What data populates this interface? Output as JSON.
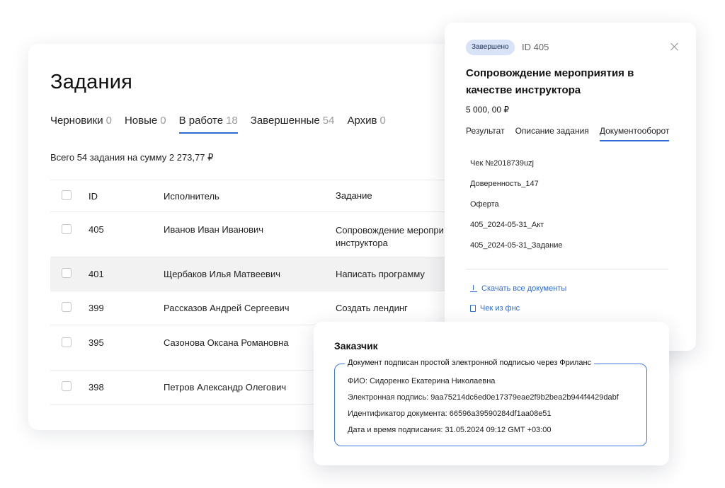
{
  "main": {
    "title": "Задания",
    "tabs": [
      {
        "label": "Черновики",
        "count": "0"
      },
      {
        "label": "Новые",
        "count": "0"
      },
      {
        "label": "В работе",
        "count": "18"
      },
      {
        "label": "Завершенные",
        "count": "54"
      },
      {
        "label": "Архив",
        "count": "0"
      }
    ],
    "active_tab": "В работе",
    "summary": "Всего 54 задания на сумму 2 273,77 ₽",
    "table": {
      "headers": {
        "id": "ID",
        "executor": "Исполнитель",
        "task": "Задание"
      },
      "rows": [
        {
          "id": "405",
          "executor": "Иванов Иван Иванович",
          "task": "Сопровождение меропри качестве инструктора"
        },
        {
          "id": "401",
          "executor": "Щербаков Илья Матвеевич",
          "task": "Написать программу"
        },
        {
          "id": "399",
          "executor": "Рассказов Андрей Сергеевич",
          "task": "Создать лендинг"
        },
        {
          "id": "395",
          "executor": "Сазонова Оксана Романовна",
          "task": ""
        },
        {
          "id": "398",
          "executor": "Петров Александр Олегович",
          "task": ""
        }
      ]
    }
  },
  "side": {
    "status": "Завершено",
    "id_label": "ID  405",
    "title": "Сопровождение мероприятия в качестве инструктора",
    "price": "5 000, 00 ₽",
    "tabs": [
      "Результат",
      "Описание задания",
      "Документооборот"
    ],
    "active_tab": "Документооборот",
    "documents": [
      "Чек №2018739uzj",
      "Доверенность_147",
      "Оферта",
      "405_2024-05-31_Акт",
      "405_2024-05-31_Задание"
    ],
    "download_all": "Скачать все документы",
    "fns_receipt": "Чек из фнс"
  },
  "customer": {
    "title": "Заказчик",
    "legend": "Документ подписан простой электронной подписью через Фриланс",
    "lines": [
      "ФИО: Сидоренко Екатерина Николаевна",
      "Электронная подпись: 9aa75214dc6ed0e17379eae2f9b2bea2b944f4429dabf",
      "Идентификатор документа: 66596a39590284df1aa08e51",
      "Дата и время подписания: 31.05.2024 09:12 GMT +03:00"
    ]
  },
  "colors": {
    "accent": "#2f6bd8",
    "badge_bg": "#d9e3f7",
    "row_highlight": "#f2f2f2"
  }
}
